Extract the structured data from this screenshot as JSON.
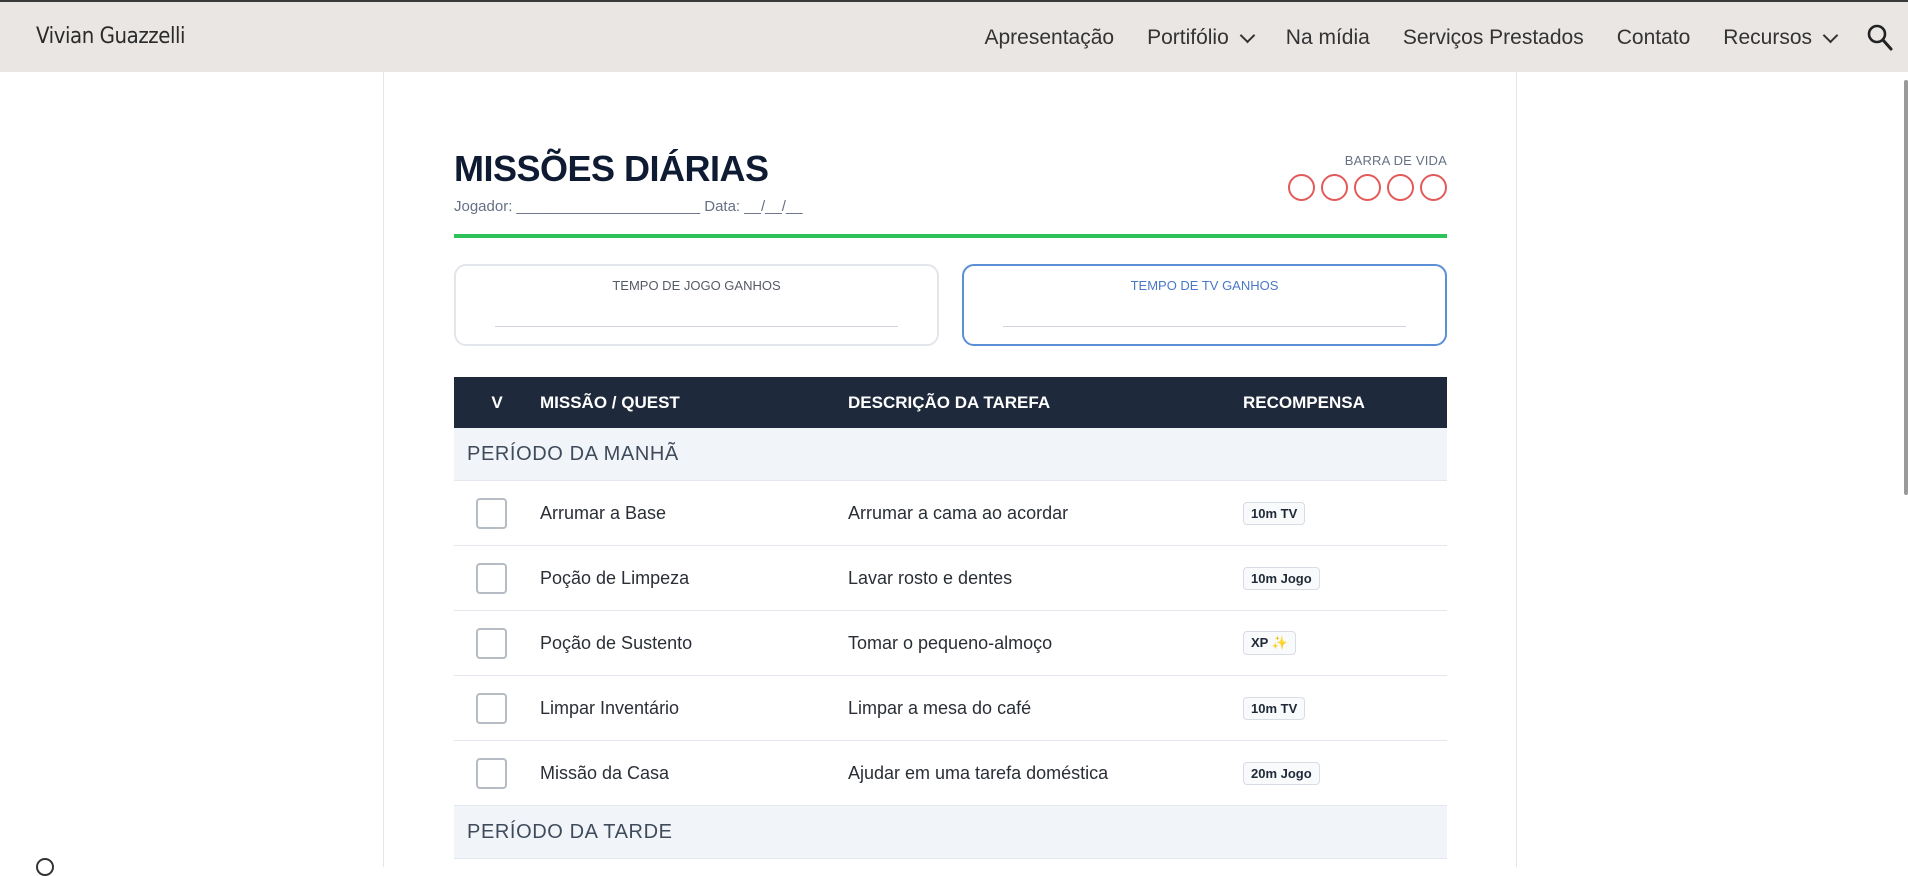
{
  "site": {
    "title": "Vivian Guazzelli",
    "nav": [
      {
        "label": "Apresentação",
        "dropdown": false
      },
      {
        "label": "Portifólio",
        "dropdown": true
      },
      {
        "label": "Na mídia",
        "dropdown": false
      },
      {
        "label": "Serviços Prestados",
        "dropdown": false
      },
      {
        "label": "Contato",
        "dropdown": false
      },
      {
        "label": "Recursos",
        "dropdown": true
      }
    ],
    "search_icon": "search-icon"
  },
  "sheet": {
    "title": "MISSÕES DIÁRIAS",
    "player_line": "Jogador: ______________________ Data: __/__/__",
    "life_label": "BARRA DE VIDA",
    "life_count": 5,
    "game_box_label": "TEMPO DE JOGO GANHOS",
    "tv_box_label": "TEMPO DE TV GANHOS",
    "colors": {
      "accent_green": "#2ec25a",
      "header_dark": "#1e293b",
      "life_red": "#e25a5a",
      "tv_blue": "#5b8fd6"
    }
  },
  "table": {
    "headers": {
      "check": "V",
      "mission": "MISSÃO / QUEST",
      "desc": "DESCRIÇÃO DA TAREFA",
      "reward": "RECOMPENSA"
    },
    "sections": [
      {
        "title": "PERÍODO DA MANHÃ",
        "rows": [
          {
            "mission": "Arrumar a Base",
            "desc": "Arrumar a cama ao acordar",
            "reward": "10m TV"
          },
          {
            "mission": "Poção de Limpeza",
            "desc": "Lavar rosto e dentes",
            "reward": "10m Jogo"
          },
          {
            "mission": "Poção de Sustento",
            "desc": "Tomar o pequeno-almoço",
            "reward": "XP ✨"
          },
          {
            "mission": "Limpar Inventário",
            "desc": "Limpar a mesa do café",
            "reward": "10m TV"
          },
          {
            "mission": "Missão da Casa",
            "desc": "Ajudar em uma tarefa doméstica",
            "reward": "20m Jogo"
          }
        ]
      },
      {
        "title": "PERÍODO DA TARDE",
        "rows": []
      }
    ]
  }
}
